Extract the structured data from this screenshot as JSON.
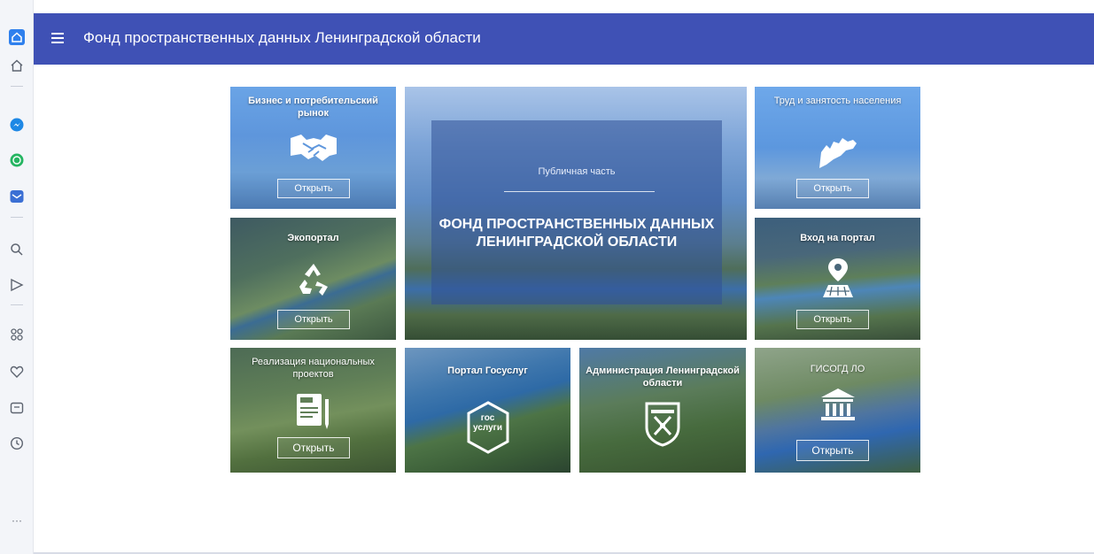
{
  "browser_sidebar": {
    "icons": [
      "home-active-icon",
      "home-outline-icon",
      "messenger-icon",
      "whatsapp-icon",
      "mail-icon",
      "search-icon",
      "send-icon",
      "apps-grid-icon",
      "heart-icon",
      "wallet-icon",
      "history-icon",
      "more-icon"
    ],
    "more_label": "···"
  },
  "header": {
    "title": "Фонд пространственных данных Ленинградской области",
    "color": "#3f51b5"
  },
  "tiles": {
    "business": {
      "label": "Бизнес и потребительский рынок",
      "button": "Открыть",
      "icon": "handshake-icon"
    },
    "labor": {
      "label": "Труд и занятость населения",
      "button": "Открыть",
      "icon": "region-map-icon"
    },
    "eco": {
      "label": "Экопортал",
      "button": "Открыть",
      "icon": "recycle-icon"
    },
    "login": {
      "label": "Вход на портал",
      "button": "Открыть",
      "icon": "map-pin-icon"
    },
    "national": {
      "label": "Реализация национальных проектов",
      "button": "Открыть",
      "icon": "document-icon"
    },
    "gosuslugi": {
      "label": "Портал Госуслуг",
      "logo": "гос\nуслуги",
      "logo_line1": "гос",
      "logo_line2": "услуги"
    },
    "admin": {
      "label": "Администрация Ленинградской области",
      "icon": "coat-of-arms-icon"
    },
    "gisogd": {
      "label": "ГИСОГД ЛО",
      "button": "Открыть",
      "icon": "building-icon"
    },
    "center": {
      "subtitle": "Публичная часть",
      "title": "ФОНД ПРОСТРАНСТВЕННЫХ ДАННЫХ ЛЕНИНГРАДСКОЙ ОБЛАСТИ"
    }
  }
}
